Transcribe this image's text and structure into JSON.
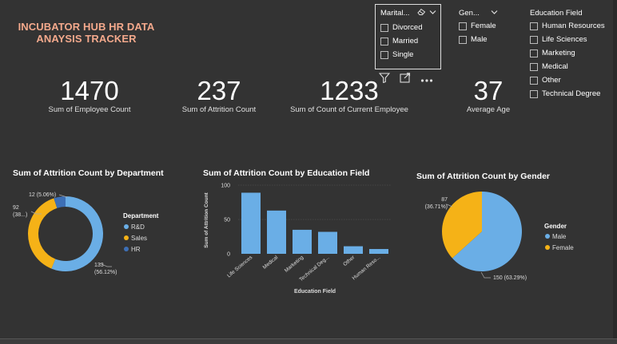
{
  "title": "INCUBATOR HUB HR DATA ANAYSIS TRACKER",
  "cards": [
    {
      "value": "1470",
      "label": "Sum of Employee Count"
    },
    {
      "value": "237",
      "label": "Sum of Attrition Count"
    },
    {
      "value": "1233",
      "label": "Sum of Count of Current Employee"
    },
    {
      "value": "37",
      "label": "Average Age"
    }
  ],
  "slicers": {
    "marital": {
      "header": "Marital...",
      "options": [
        "Divorced",
        "Married",
        "Single"
      ]
    },
    "gender": {
      "header": "Gen...",
      "options": [
        "Female",
        "Male"
      ]
    },
    "education": {
      "header": "Education Field",
      "options": [
        "Human Resources",
        "Life Sciences",
        "Marketing",
        "Medical",
        "Other",
        "Technical Degree"
      ]
    }
  },
  "icons": [
    "eraser-icon",
    "chevron-down-icon",
    "filter-icon",
    "focus-mode-icon",
    "more-options-icon"
  ],
  "colors": {
    "blue": "#6aaee6",
    "yellow": "#f5b217",
    "darkblue": "#3d6fb5",
    "title": "#f4a98c",
    "background": "#333333"
  },
  "chart_data": [
    {
      "type": "pie",
      "variant": "donut",
      "title": "Sum of Attrition Count by Department",
      "legend_title": "Department",
      "legend_placement": "right",
      "categories": [
        "R&D",
        "Sales",
        "HR"
      ],
      "values": [
        133,
        92,
        12
      ],
      "data_labels": [
        "133\n(56.12%)",
        "92\n(38...)",
        "12 (5.06%)"
      ]
    },
    {
      "type": "bar",
      "title": "Sum of Attrition Count by Education Field",
      "xlabel": "Education Field",
      "ylabel": "Sum of Attrition Count",
      "ylim": [
        0,
        100
      ],
      "yticks": [
        "0",
        "50",
        "100"
      ],
      "categories": [
        "Life Sciences",
        "Medical",
        "Marketing",
        "Technical Deg...",
        "Other",
        "Human Reso..."
      ],
      "values": [
        89,
        63,
        35,
        32,
        11,
        7
      ],
      "grid": true
    },
    {
      "type": "pie",
      "title": "Sum of Attrition Count by Gender",
      "legend_title": "Gender",
      "legend_placement": "right",
      "categories": [
        "Male",
        "Female"
      ],
      "values": [
        150,
        87
      ],
      "data_labels": [
        "150 (63.29%)",
        "87\n(36.71%)"
      ]
    }
  ]
}
